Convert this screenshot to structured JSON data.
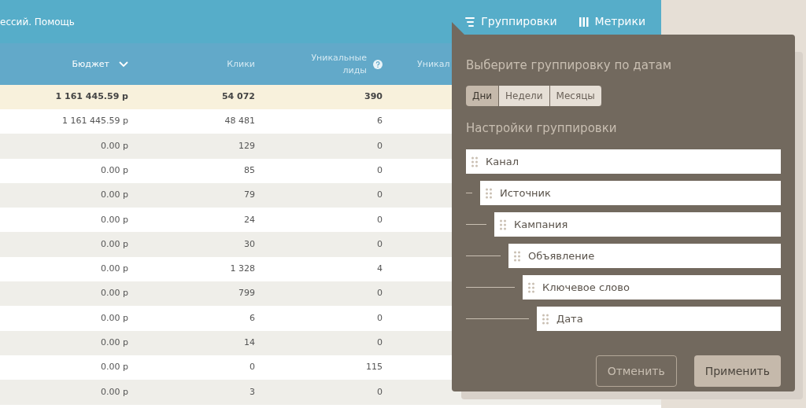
{
  "top_bar": {
    "breadcrumb": "ессий. Помощь",
    "nav": [
      {
        "label": "Группировки",
        "kind": "groups"
      },
      {
        "label": "Метрики",
        "kind": "metrics"
      }
    ]
  },
  "table": {
    "columns": [
      {
        "label": "Бюджет",
        "sorted": true
      },
      {
        "label": "Клики",
        "sorted": false
      },
      {
        "label": "Уникальные лиды",
        "sorted": false,
        "help": true
      },
      {
        "label": "Уникал",
        "sorted": false
      }
    ],
    "total": [
      "1 161 445.59 р",
      "54 072",
      "390"
    ],
    "rows": [
      [
        "1 161 445.59 р",
        "48 481",
        "6"
      ],
      [
        "0.00 р",
        "129",
        "0"
      ],
      [
        "0.00 р",
        "85",
        "0"
      ],
      [
        "0.00 р",
        "79",
        "0"
      ],
      [
        "0.00 р",
        "24",
        "0"
      ],
      [
        "0.00 р",
        "30",
        "0"
      ],
      [
        "0.00 р",
        "1 328",
        "4"
      ],
      [
        "0.00 р",
        "799",
        "0"
      ],
      [
        "0.00 р",
        "6",
        "0"
      ],
      [
        "0.00 р",
        "14",
        "0"
      ],
      [
        "0.00 р",
        "0",
        "115"
      ],
      [
        "0.00 р",
        "3",
        "0"
      ]
    ]
  },
  "popup": {
    "date_title": "Выберите группировку по датам",
    "date_tabs": [
      {
        "label": "Дни",
        "selected": true
      },
      {
        "label": "Недели",
        "selected": false
      },
      {
        "label": "Месяцы",
        "selected": false
      }
    ],
    "settings_title": "Настройки группировки",
    "levels": [
      {
        "label": "Канал",
        "children": [
          {
            "label": "Источник",
            "children": [
              {
                "label": "Кампания",
                "children": [
                  {
                    "label": "Объявление",
                    "children": [
                      {
                        "label": "Ключевое слово",
                        "children": [
                          {
                            "label": "Дата"
                          }
                        ]
                      }
                    ]
                  }
                ]
              }
            ]
          }
        ]
      }
    ],
    "buttons": [
      {
        "label": "Отменить",
        "kind": "secondary"
      },
      {
        "label": "Применить",
        "kind": "primary"
      }
    ]
  }
}
